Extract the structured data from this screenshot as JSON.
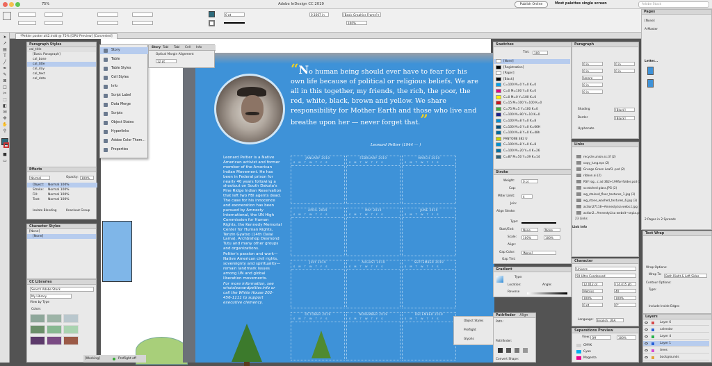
{
  "app": {
    "title": "Adobe InDesign CC 2019",
    "publish": "Publish Online",
    "workspace": "Most palettes single screen",
    "search_placeholder": "Adobe Stock",
    "zoom": "75%"
  },
  "document_tab": "*Peltier poster alt2.indd @ 75% [GPU Preview] [Converted]",
  "control": {
    "stroke_weight": "0 pt",
    "dimension": "0.1667 in",
    "frame_style": "[Basic Graphics Frame]+",
    "percent": "100%"
  },
  "paragraph_styles": {
    "title": "Paragraph Styles",
    "current": "cal_title",
    "items": [
      "[Basic Paragraph]",
      "cal_base",
      "cal_title",
      "cal_day",
      "cal_text",
      "cal_date"
    ],
    "selected": 2
  },
  "effects": {
    "title": "Effects",
    "mode": "Normal",
    "opacity_label": "Opacity:",
    "opacity": "100%",
    "rows": [
      [
        "Object:",
        "Normal 100%"
      ],
      [
        "Stroke:",
        "Normal 100%"
      ],
      [
        "Fill:",
        "Normal 100%"
      ],
      [
        "Text:",
        "Normal 100%"
      ]
    ],
    "isolate": "Isolate Blending",
    "knockout": "Knockout Group"
  },
  "character_styles": {
    "title": "Character Styles",
    "current": "[None]",
    "item": "[None]"
  },
  "cc_libraries": {
    "title": "CC Libraries",
    "search": "Search Adobe Stock",
    "library": "My Library",
    "view": "View by Type",
    "colors_label": "Colors",
    "colors": [
      "#8ea79a",
      "#9db4a7",
      "#b9c7cd",
      "#6b8f6a",
      "#87b891",
      "#a9d3b0",
      "#5c3a6b",
      "#7a4b84",
      "#9b5a47"
    ]
  },
  "object_menu": {
    "items": [
      "Story",
      "Table",
      "Table Styles",
      "Cell Styles",
      "Info",
      "Script Label",
      "Data Merge",
      "Scripts",
      "Object States",
      "Hyperlinks",
      "Adobe Color Them...",
      "Properties"
    ]
  },
  "story_panel": {
    "tabs": [
      "Story",
      "Tabl",
      "Tabl",
      "Cell",
      "Info"
    ],
    "optical": "Optical Margin Alignment",
    "size": "12 pt"
  },
  "poster": {
    "quote_mark_open": "“",
    "quote_first": "N",
    "quote": "o human being should ever have to fear for his own life because of political or religious beliefs. We are all in this together, my friends, the rich, the poor, the red, white, black, brown and yellow. We share responsibility for Mother Earth and those who live and breathe upon her — never forget that.",
    "quote_mark_close": "”",
    "author": "Leonard Peltier (1944 — )",
    "bio_1": "Leonard Peltier is a Native American activist and former member of the American Indian Movement. He has been in Federal prison for nearly 40 years following a shootout on South Dakota's Pine Ridge Indian Reservation that left two FBI agents dead. The case for his innocence and exoneration has been pursued by Amnesty International, the UN High Commission for Human Rights, the Kennedy Memorial Center for Human Rights, Tenzin Gyatso (14th Dalai Lama), Archbishop Desmond Tutu and many other groups and organizations.",
    "bio_2": "Peltier's passion and work—Native American civil rights, sovereignty and spirituality—remain landmark issues among UN and global liberation movements.",
    "bio_3": "For more information, see whoisleonardpeltier.info or call the White House 202-456-1111 to support executive clemency.",
    "months": [
      "JANUARY 2019",
      "FEBRUARY 2019",
      "MARCH 2019",
      "APRIL 2019",
      "MAY 2019",
      "JUNE 2019",
      "JULY 2019",
      "AUGUST 2019",
      "SEPTEMBER 2019",
      "OCTOBER 2019",
      "NOVEMBER 2019",
      "DECEMBER 2019"
    ],
    "weekdays": "S M T W T F S"
  },
  "swatches": {
    "title": "Swatches",
    "tint_label": "Tint:",
    "tint": "100",
    "items": [
      [
        "[None]",
        "#ffffff"
      ],
      [
        "[Registration]",
        "#000000"
      ],
      [
        "[Paper]",
        "#ffffff"
      ],
      [
        "[Black]",
        "#000000"
      ],
      [
        "C=100 M=0 Y=0 K=0",
        "#00a0e9"
      ],
      [
        "C=0 M=100 Y=0 K=0",
        "#e4007f"
      ],
      [
        "C=0 M=0 Y=100 K=0",
        "#fff100"
      ],
      [
        "C=15 M=100 Y=100 K=0",
        "#c8161d"
      ],
      [
        "C=75 M=5 Y=100 K=0",
        "#3cae3a"
      ],
      [
        "C=100 M=90 Y=10 K=0",
        "#1d2088"
      ],
      [
        "C=100 M=8 Y=0 K=8",
        "#0090d0"
      ],
      [
        "C=100 M=0 Y=0 K=66H",
        "#004f7c"
      ],
      [
        "C=100 M=8 Y=0 K=48h",
        "#006a9a"
      ],
      [
        "PANTONE 382 U",
        "#c7d300"
      ],
      [
        "C=100 M=8 Y=0 K=8",
        "#0090d0"
      ],
      [
        "C=100 M=20 Y=4 K=26",
        "#006f9f"
      ],
      [
        "C=87 M=50 Y=39 K=14",
        "#2d6278"
      ]
    ]
  },
  "stroke": {
    "title": "Stroke",
    "weight_label": "Weight:",
    "weight": "0 pt",
    "cap": "Cap:",
    "miter_label": "Miter Limit:",
    "miter": "4",
    "join": "Join:",
    "align": "Align Stroke:",
    "type": "Type:",
    "startend": "Start/End:",
    "startend_val": "None",
    "scale": "Scale:",
    "scale_val": "100%",
    "align2": "Align:",
    "gap_color": "Gap Color:",
    "gap_val": "[None]",
    "gap_tint": "Gap Tint:"
  },
  "gradient": {
    "title": "Gradient",
    "type": "Type:",
    "location": "Location:",
    "angle": "Angle:",
    "reverse": "Reverse"
  },
  "pathfinder": {
    "tabs": [
      "Pathfinder",
      "Align"
    ],
    "path": "Path:",
    "pf": "Pathfinder:",
    "convert": "Convert Shape:"
  },
  "mini_panel": {
    "items": [
      "Object Styles",
      "Preflight",
      "Glyphs"
    ]
  },
  "paragraph": {
    "title": "Paragraph",
    "indent": "0 in",
    "ignore": "Ignore",
    "shading": "Shading",
    "border": "Border",
    "black": "[Black]",
    "hyphenate": "Hyphenate"
  },
  "links": {
    "title": "Links",
    "items": [
      "recycle.union.ss.tif (2)",
      "copy_lung.eps (2)",
      "Grunge Green Leaf3 .psd (2)",
      "ribbon.ai (2)",
      "RSF log...c ad 362+199for-folder.psd (2)",
      "scratched glass.JPG (2)",
      "wg_stained_floor_textures_1.jpg (3)",
      "wg_stone_washed_textures_6.jpg (3)",
      "action27118~Amnesty.lsa webs.t.jpg",
      "action2...AmnestyLisa websit~sepia.psd"
    ],
    "count": "23 Links",
    "info": "Link Info"
  },
  "character": {
    "title": "Character",
    "font": "Univers",
    "style": "59 Ultra Condensed",
    "size": "12.012 pt",
    "leading": "(14.415 pt)",
    "kerning": "Metrics",
    "tracking": "40",
    "vscale": "100%",
    "hscale": "100%",
    "baseline": "0 pt",
    "skew": "0°",
    "language_label": "Language:",
    "language": "English: USA"
  },
  "separations": {
    "title": "Separations Preview",
    "view_label": "View:",
    "view": "Off",
    "percent": "100%",
    "items": [
      [
        "CMYK",
        "#cfcfcf"
      ],
      [
        "Cyan",
        "#00aeef"
      ],
      [
        "Magenta",
        "#ec008c"
      ]
    ]
  },
  "pages": {
    "title": "Pages",
    "none": "[None]",
    "master": "A-Master",
    "page_label": "Letter...",
    "footer": "2 Pages in 2 Spreads"
  },
  "text_wrap": {
    "title": "Text Wrap",
    "wrap_options": "Wrap Options:",
    "wrap_to": "Wrap To:",
    "wrap_val": "Both Right & Left Sides",
    "contour": "Contour Options:",
    "type": "Type:",
    "include": "Include Inside Edges"
  },
  "layers": {
    "title": "Layers",
    "items": [
      [
        "Layer 6",
        "#d64a4a"
      ],
      [
        "calendar",
        "#2a61d6"
      ],
      [
        "Layer 4",
        "#29b34a"
      ],
      [
        "Layer 1",
        "#2a61d6"
      ],
      [
        "trees",
        "#d649d0"
      ],
      [
        "backgrounds",
        "#e3a33a"
      ]
    ],
    "selected": 3
  },
  "status": {
    "preflight": "Preflight off",
    "working": "[Working]"
  }
}
